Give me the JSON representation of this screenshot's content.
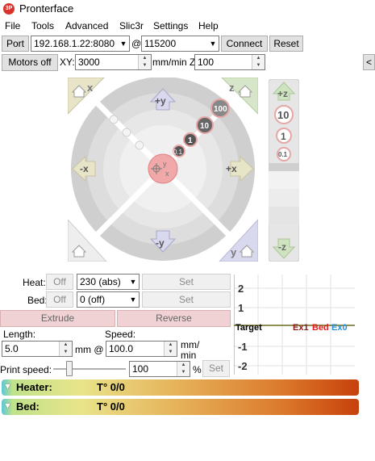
{
  "window": {
    "title": "Pronterface",
    "icon_label": "3P"
  },
  "menu": [
    "File",
    "Tools",
    "Advanced",
    "Slic3r",
    "Settings",
    "Help"
  ],
  "connection": {
    "port_label": "Port",
    "port_value": "192.168.1.22:8080",
    "at_label": "@",
    "baud_value": "115200",
    "connect_label": "Connect",
    "reset_label": "Reset"
  },
  "motion": {
    "motors_off_label": "Motors off",
    "xy_label": "XY:",
    "xy_value": "3000",
    "z_label": "mm/min Z:",
    "z_value": "100",
    "collapse_label": "<"
  },
  "jog": {
    "up_label": "+y",
    "down_label": "-y",
    "left_label": "-x",
    "right_label": "+x",
    "home_x": "x",
    "home_z": "z",
    "home_y": "y",
    "steps": [
      "0.1",
      "1",
      "10",
      "100"
    ],
    "center_labels": [
      "y",
      "x"
    ],
    "z_up": "+z",
    "z_down": "-z",
    "z_steps": [
      "10",
      "1",
      "0.1"
    ]
  },
  "temperature": {
    "heat_label": "Heat:",
    "bed_label": "Bed:",
    "off_label": "Off",
    "heat_value": "230 (abs)",
    "bed_value": "0 (off)",
    "set_label": "Set"
  },
  "extrude": {
    "extrude_label": "Extrude",
    "reverse_label": "Reverse",
    "length_label": "Length:",
    "length_value": "5.0",
    "length_unit": "mm @",
    "speed_label": "Speed:",
    "speed_value": "100.0",
    "speed_unit_1": "mm/",
    "speed_unit_2": "min"
  },
  "print_speed": {
    "label": "Print speed:",
    "value": "100",
    "unit": "%",
    "set_label": "Set",
    "level": 0.18
  },
  "graph": {
    "y_ticks": [
      "2",
      "1",
      "-1",
      "-2"
    ],
    "legend_target": "Target",
    "legend_ex1": "Ex1",
    "legend_bed": "Bed",
    "legend_ex0": "Ex0",
    "colors": {
      "ex1": "#8b1a1a",
      "bed": "#e02020",
      "ex0": "#2a8fd8",
      "target": "#000000"
    }
  },
  "gauges": [
    {
      "label": "Heater:",
      "value": "T° 0/0"
    },
    {
      "label": "Bed:",
      "value": "T° 0/0"
    }
  ]
}
